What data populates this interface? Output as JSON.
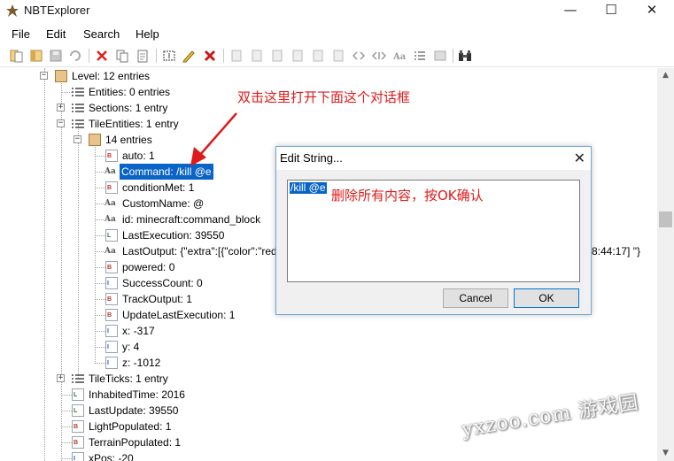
{
  "window": {
    "title": "NBTExplorer",
    "minimize": "—",
    "maximize": "☐",
    "close": "✕"
  },
  "menu": {
    "file": "File",
    "edit": "Edit",
    "search": "Search",
    "help": "Help"
  },
  "toolbar": {
    "icons": [
      "open-folder-icon",
      "open-file-icon",
      "save-icon",
      "refresh-icon",
      "cut-icon",
      "copy-icon",
      "paste-icon",
      "rename-icon",
      "edit-icon",
      "delete-icon",
      "add-byte-icon",
      "add-short-icon",
      "add-int-icon",
      "add-long-icon",
      "add-float-icon",
      "add-double-icon",
      "add-byte-array-icon",
      "add-int-array-icon",
      "add-string-icon",
      "add-list-icon",
      "add-compound-icon",
      "find-icon"
    ]
  },
  "tree": {
    "rows": [
      {
        "text": "Level: 12 entries",
        "type": "compound"
      },
      {
        "text": "Entities: 0 entries",
        "type": "list"
      },
      {
        "text": "Sections: 1 entry",
        "type": "list"
      },
      {
        "text": "TileEntities: 1 entry",
        "type": "list"
      },
      {
        "text": "14 entries",
        "type": "compound"
      },
      {
        "text": "auto: 1",
        "type": "byte",
        "icon_letter": "B"
      },
      {
        "text": "Command: /kill @e",
        "type": "string",
        "selected": true
      },
      {
        "text": "conditionMet: 1",
        "type": "byte",
        "icon_letter": "B"
      },
      {
        "text": "CustomName: @",
        "type": "string"
      },
      {
        "text": "id: minecraft:command_block",
        "type": "string"
      },
      {
        "text": "LastExecution: 39550",
        "type": "long",
        "icon_letter": "L"
      },
      {
        "text": "LastOutput: {\"extra\":[{\"color\":\"red\",\"",
        "type": "string",
        "tail": "8:44:17] \"}"
      },
      {
        "text": "powered: 0",
        "type": "byte",
        "icon_letter": "B"
      },
      {
        "text": "SuccessCount: 0",
        "type": "int",
        "icon_letter": "I"
      },
      {
        "text": "TrackOutput: 1",
        "type": "byte",
        "icon_letter": "B"
      },
      {
        "text": "UpdateLastExecution: 1",
        "type": "byte",
        "icon_letter": "B"
      },
      {
        "text": "x: -317",
        "type": "int",
        "icon_letter": "I"
      },
      {
        "text": "y: 4",
        "type": "int",
        "icon_letter": "I"
      },
      {
        "text": "z: -1012",
        "type": "int",
        "icon_letter": "I"
      },
      {
        "text": "TileTicks: 1 entry",
        "type": "list"
      },
      {
        "text": "InhabitedTime: 2016",
        "type": "long",
        "icon_letter": "L"
      },
      {
        "text": "LastUpdate: 39550",
        "type": "long",
        "icon_letter": "L"
      },
      {
        "text": "LightPopulated: 1",
        "type": "byte",
        "icon_letter": "B"
      },
      {
        "text": "TerrainPopulated: 1",
        "type": "byte",
        "icon_letter": "B"
      },
      {
        "text": "xPos: -20",
        "type": "int",
        "icon_letter": "I"
      }
    ]
  },
  "annotations": {
    "top": "双击这里打开下面这个对话框",
    "dialog": "删除所有内容，按OK确认"
  },
  "dialog": {
    "title": "Edit String...",
    "close": "✕",
    "value": "/kill @e",
    "cancel_label": "Cancel",
    "ok_label": "OK"
  },
  "watermark": "yxzoo.com 游戏园",
  "colors": {
    "selection": "#0a64c8",
    "annotation": "#e0191a",
    "dialog_border": "#6fa8d9"
  }
}
